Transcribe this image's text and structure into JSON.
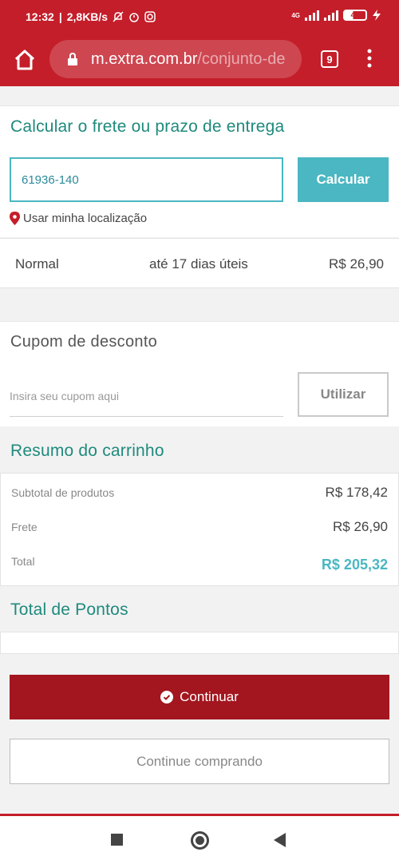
{
  "status_bar": {
    "time": "12:32",
    "speed": "2,8KB/s",
    "network": "4G",
    "battery": "41"
  },
  "browser": {
    "url_host": "m.extra.com.br",
    "url_path": "/conjunto-de",
    "tab_count": "9"
  },
  "freight": {
    "title": "Calcular o frete ou prazo de entrega",
    "cep_value": "61936-140",
    "calculate_label": "Calcular",
    "location_label": "Usar minha localização"
  },
  "shipping_option": {
    "name": "Normal",
    "time": "até 17 dias úteis",
    "price": "R$ 26,90"
  },
  "coupon": {
    "title": "Cupom de desconto",
    "placeholder": "Insira seu cupom aqui",
    "apply_label": "Utilizar"
  },
  "summary": {
    "title": "Resumo do carrinho",
    "rows": [
      {
        "label": "Subtotal de produtos",
        "value": "R$ 178,42"
      },
      {
        "label": "Frete",
        "value": "R$ 26,90"
      },
      {
        "label": "Total",
        "value": "R$ 205,32"
      }
    ]
  },
  "points": {
    "title": "Total de Pontos"
  },
  "actions": {
    "continue_label": "Continuar",
    "keep_shopping_label": "Continue comprando"
  },
  "colors": {
    "brand_red": "#c41e2a",
    "button_red": "#a3161f",
    "accent_teal": "#4ab7c2",
    "title_teal": "#1f8a7d"
  }
}
